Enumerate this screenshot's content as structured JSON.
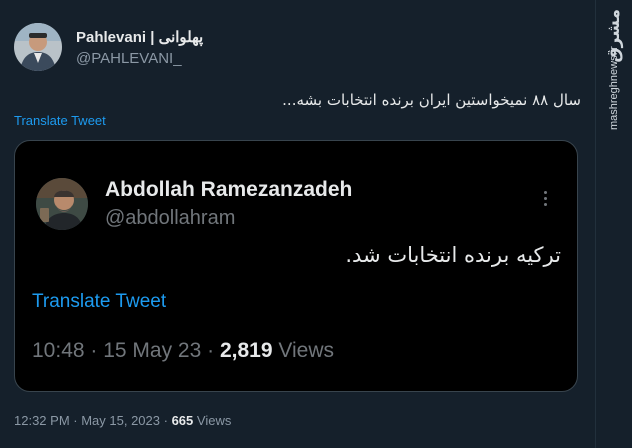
{
  "tweet": {
    "author_name": "Pahlevani | پهلوانی",
    "author_handle": "@PAHLEVANI_",
    "text": "سال ۸۸ نمیخواستین ایران برنده انتخابات بشه...",
    "translate_label": "Translate Tweet",
    "time": "12:32 PM",
    "date": "May 15, 2023",
    "views_count": "665",
    "views_label": "Views"
  },
  "quoted": {
    "author_name": "Abdollah Ramezanzadeh",
    "author_handle": "@abdollahram",
    "text": "ترکیه برنده انتخابات شد.",
    "translate_label": "Translate Tweet",
    "time": "10:48",
    "date": "15 May 23",
    "views_count": "2,819",
    "views_label": "Views"
  },
  "watermark": {
    "logo": "مشرق",
    "site": "mashreghnews.ir"
  },
  "colors": {
    "background": "#15202b",
    "quote_background": "#000000",
    "link": "#1d9bf0",
    "secondary_text": "#8b98a5"
  },
  "icons": {
    "more": "more-vertical-icon"
  }
}
